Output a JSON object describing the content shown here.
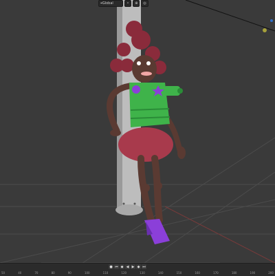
{
  "header": {
    "orientation_label": "Global",
    "icons": [
      "transform-orientation-icon",
      "pivot-icon",
      "snap-icon",
      "proportional-icon"
    ]
  },
  "timeline": {
    "controls": [
      "jump-start",
      "prev-keyframe",
      "play-reverse",
      "play",
      "next-keyframe",
      "jump-end"
    ],
    "frames": [
      "50",
      "40",
      "70",
      "80",
      "90",
      "100",
      "110",
      "120",
      "130",
      "140",
      "150",
      "160",
      "170",
      "180",
      "190",
      "200"
    ]
  },
  "colors": {
    "viewport_bg": "#3a3a3a",
    "grid": "#4a4a4a",
    "shirt": "#3fb34a",
    "hair": "#8a2b3b",
    "skirt": "#a83a4c",
    "shoes": "#8b3fd9",
    "skin": "#5a3a32",
    "pole": "#bdbdbd"
  }
}
